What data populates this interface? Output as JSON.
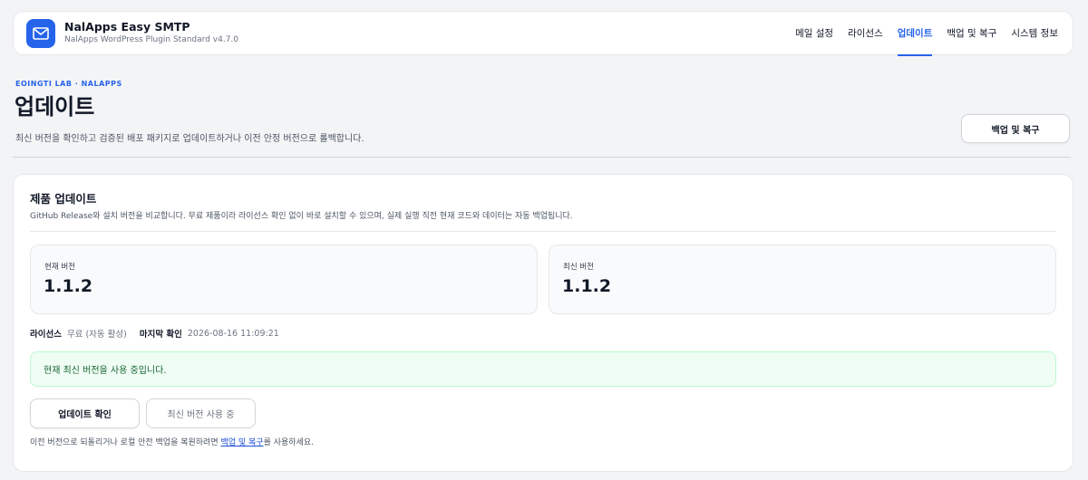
{
  "app": {
    "name": "NalApps Easy SMTP",
    "subtitle": "NalApps WordPress Plugin Standard v4.7.0",
    "logo_icon": "mail-icon",
    "accent_color": "#2563eb"
  },
  "nav": {
    "items": [
      {
        "label": "메일 설정",
        "active": false
      },
      {
        "label": "라이선스",
        "active": false
      },
      {
        "label": "업데이트",
        "active": true
      },
      {
        "label": "백업 및 복구",
        "active": false
      },
      {
        "label": "시스템 정보",
        "active": false
      }
    ]
  },
  "header": {
    "eyebrow": "EOINGTI LAB · NALAPPS",
    "title": "업데이트",
    "description": "최신 버전을 확인하고 검증된 배포 패키지로 업데이트하거나 이전 안정 버전으로 롤백합니다.",
    "backup_button": "백업 및 복구"
  },
  "card": {
    "title": "제품 업데이트",
    "description": "GitHub Release와 설치 버전을 비교합니다. 무료 제품이라 라이선스 확인 없이 바로 설치할 수 있으며, 실제 실행 직전 현재 코드와 데이터는 자동 백업됩니다.",
    "current_version": {
      "label": "현재 버전",
      "value": "1.1.2"
    },
    "latest_version": {
      "label": "최신 버전",
      "value": "1.1.2"
    },
    "meta": {
      "license_label": "라이선스",
      "license_value": "무료 (자동 활성)",
      "last_check_label": "마지막 확인",
      "last_check_value": "2026-08-16 11:09:21"
    },
    "alert": {
      "text": "현재 최신 버전을 사용 중입니다.",
      "color": "#166534"
    },
    "buttons": {
      "check_update": "업데이트 확인",
      "latest_in_use": "최신 버전 사용 중"
    },
    "footnote": {
      "before": "이전 버전으로 되돌리거나 로컬 안전 백업을 복원하려면 ",
      "link": "백업 및 복구",
      "after": "를 사용하세요."
    }
  }
}
